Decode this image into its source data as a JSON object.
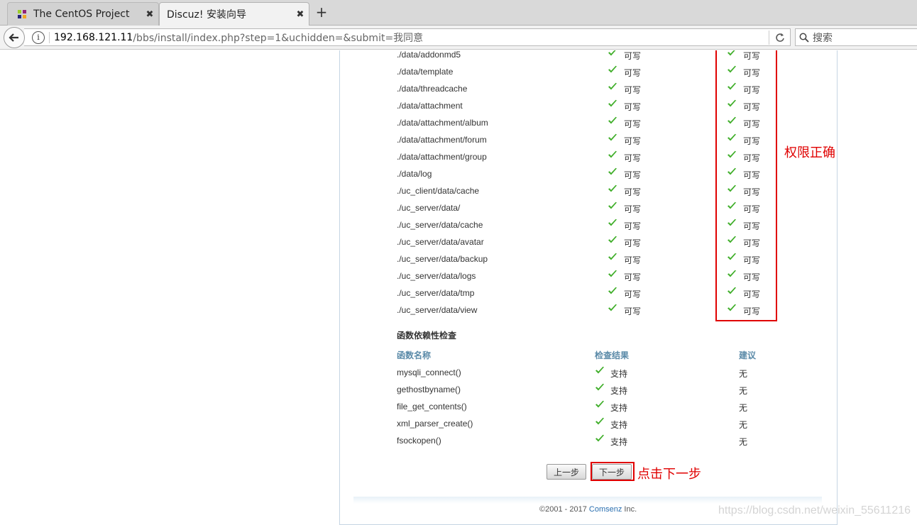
{
  "browser": {
    "tabs": [
      {
        "title": "The CentOS Project",
        "active": false,
        "close": "✖"
      },
      {
        "title": "Discuz! 安装向导",
        "active": true,
        "close": "✖"
      }
    ],
    "new_tab": "+",
    "url_host": "192.168.121.11",
    "url_path": "/bbs/install/index.php?step=1&uchidden=&submit=我同意",
    "search_placeholder": "搜索"
  },
  "dir_check": {
    "rows": [
      {
        "path": "./data/addonmd5",
        "required": "可写",
        "current": "可写"
      },
      {
        "path": "./data/template",
        "required": "可写",
        "current": "可写"
      },
      {
        "path": "./data/threadcache",
        "required": "可写",
        "current": "可写"
      },
      {
        "path": "./data/attachment",
        "required": "可写",
        "current": "可写"
      },
      {
        "path": "./data/attachment/album",
        "required": "可写",
        "current": "可写"
      },
      {
        "path": "./data/attachment/forum",
        "required": "可写",
        "current": "可写"
      },
      {
        "path": "./data/attachment/group",
        "required": "可写",
        "current": "可写"
      },
      {
        "path": "./data/log",
        "required": "可写",
        "current": "可写"
      },
      {
        "path": "./uc_client/data/cache",
        "required": "可写",
        "current": "可写"
      },
      {
        "path": "./uc_server/data/",
        "required": "可写",
        "current": "可写"
      },
      {
        "path": "./uc_server/data/cache",
        "required": "可写",
        "current": "可写"
      },
      {
        "path": "./uc_server/data/avatar",
        "required": "可写",
        "current": "可写"
      },
      {
        "path": "./uc_server/data/backup",
        "required": "可写",
        "current": "可写"
      },
      {
        "path": "./uc_server/data/logs",
        "required": "可写",
        "current": "可写"
      },
      {
        "path": "./uc_server/data/tmp",
        "required": "可写",
        "current": "可写"
      },
      {
        "path": "./uc_server/data/view",
        "required": "可写",
        "current": "可写"
      }
    ]
  },
  "func_check": {
    "title": "函数依赖性检查",
    "headers": {
      "name": "函数名称",
      "result": "检查结果",
      "advice": "建议"
    },
    "rows": [
      {
        "name": "mysqli_connect()",
        "result": "支持",
        "advice": "无"
      },
      {
        "name": "gethostbyname()",
        "result": "支持",
        "advice": "无"
      },
      {
        "name": "file_get_contents()",
        "result": "支持",
        "advice": "无"
      },
      {
        "name": "xml_parser_create()",
        "result": "支持",
        "advice": "无"
      },
      {
        "name": "fsockopen()",
        "result": "支持",
        "advice": "无"
      }
    ]
  },
  "buttons": {
    "prev": "上一步",
    "next": "下一步"
  },
  "footer": {
    "prefix": "©2001 - 2017 ",
    "brand": "Comsenz",
    "suffix": " Inc."
  },
  "annotations": {
    "permission_ok": "权限正确",
    "click_next": "点击下一步"
  },
  "watermark": "https://blog.csdn.net/weixin_55611216",
  "colors": {
    "check_green": "#3fae29",
    "annotation_red": "#e00000",
    "header_blue": "#5a8aa8"
  }
}
